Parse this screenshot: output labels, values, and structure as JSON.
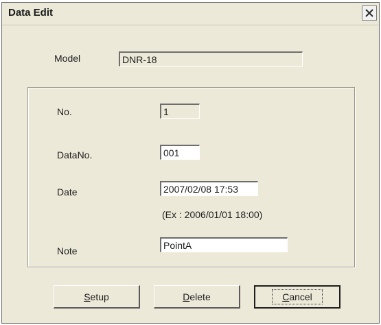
{
  "window": {
    "title": "Data Edit"
  },
  "model": {
    "label": "Model",
    "value": "DNR-18"
  },
  "fields": {
    "no": {
      "label": "No.",
      "value": "1"
    },
    "datano": {
      "label": "DataNo.",
      "value": "001"
    },
    "date": {
      "label": "Date",
      "value": "2007/02/08 17:53",
      "hint": "(Ex : 2006/01/01 18:00)"
    },
    "note": {
      "label": "Note",
      "value": "PointA"
    }
  },
  "buttons": {
    "setup": {
      "mnemonic": "S",
      "rest": "etup"
    },
    "delete": {
      "mnemonic": "D",
      "rest": "elete"
    },
    "cancel": {
      "mnemonic": "C",
      "rest": "ancel"
    }
  }
}
